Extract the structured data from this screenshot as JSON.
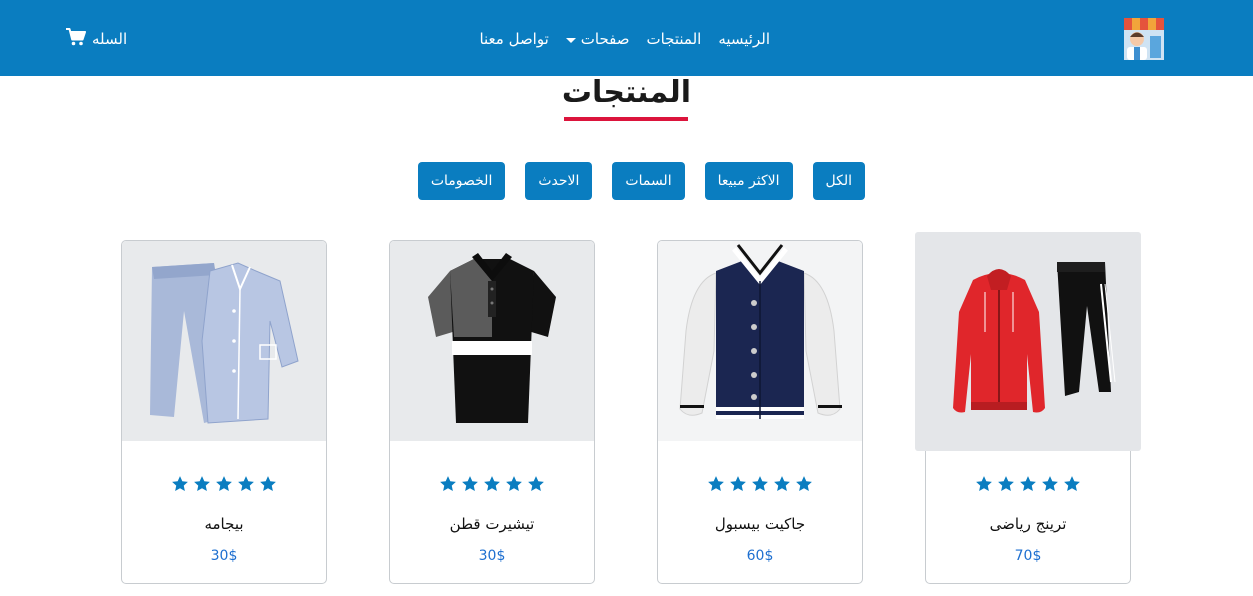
{
  "navbar": {
    "logo_icon": "shop-vendor-icon",
    "links": [
      "الرئيسيه",
      "المنتجات",
      "صفحات",
      "تواصل معنا"
    ],
    "cart_label": "السله",
    "cart_icon": "cart-icon",
    "background": "#0a7dc0"
  },
  "section": {
    "title": "المنتجات",
    "underline_color": "#dc143c"
  },
  "filters": [
    "الكل",
    "الاكثر مبيعا",
    "السمات",
    "الاحدث",
    "الخصومات"
  ],
  "products": [
    {
      "name": "ترينج رياضى",
      "price": "70$",
      "rating": 5,
      "image_icon": "tracksuit-image"
    },
    {
      "name": "جاكيت بيسبول",
      "price": "60$",
      "rating": 5,
      "image_icon": "baseball-jacket-image"
    },
    {
      "name": "تيشيرت قطن",
      "price": "30$",
      "rating": 5,
      "image_icon": "polo-shirt-image"
    },
    {
      "name": "بيجامه",
      "price": "30$",
      "rating": 5,
      "image_icon": "pajamas-image"
    }
  ],
  "colors": {
    "accent": "#0a7dc0",
    "star": "#0a7dc0",
    "price": "#1d6fd0"
  }
}
